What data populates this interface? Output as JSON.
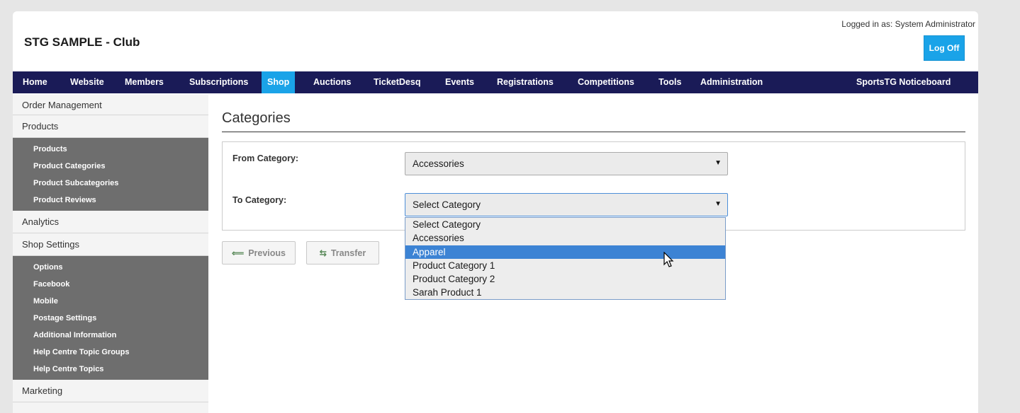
{
  "header": {
    "site_title": "STG SAMPLE - Club",
    "logged_in": "Logged in as: System Administrator",
    "logoff_label": "Log Off"
  },
  "topnav": {
    "items": [
      "Home",
      "Website",
      "Members",
      "Subscriptions",
      "Shop",
      "Auctions",
      "TicketDesq",
      "Events",
      "Registrations",
      "Competitions",
      "Tools",
      "Administration"
    ],
    "active": "Shop",
    "right_item": "SportsTG Noticeboard"
  },
  "sidebar": {
    "sections": [
      {
        "label": "Order Management",
        "items": []
      },
      {
        "label": "Products",
        "items": [
          "Products",
          "Product Categories",
          "Product Subcategories",
          "Product Reviews"
        ]
      },
      {
        "label": "Analytics",
        "items": []
      },
      {
        "label": "Shop Settings",
        "items": [
          "Options",
          "Facebook",
          "Mobile",
          "Postage Settings",
          "Additional Information",
          "Help Centre Topic Groups",
          "Help Centre Topics"
        ]
      },
      {
        "label": "Marketing",
        "items": []
      }
    ]
  },
  "main": {
    "title": "Categories",
    "from_label": "From Category:",
    "from_value": "Accessories",
    "to_label": "To Category:",
    "to_value": "Select Category",
    "to_options": [
      "Select Category",
      "Accessories",
      "Apparel",
      "Product Category 1",
      "Product Category 2",
      "Sarah Product 1"
    ],
    "highlighted_option": "Apparel",
    "previous_label": "Previous",
    "transfer_label": "Transfer"
  },
  "colors": {
    "nav_bg": "#1a1b57",
    "accent": "#1aa3e8",
    "submenu_bg": "#6e6e6e",
    "option_highlight": "#3c83d4"
  },
  "icons": {
    "previous": "arrow-left-icon",
    "transfer": "transfer-icon",
    "cursor": "mouse-pointer-icon"
  }
}
